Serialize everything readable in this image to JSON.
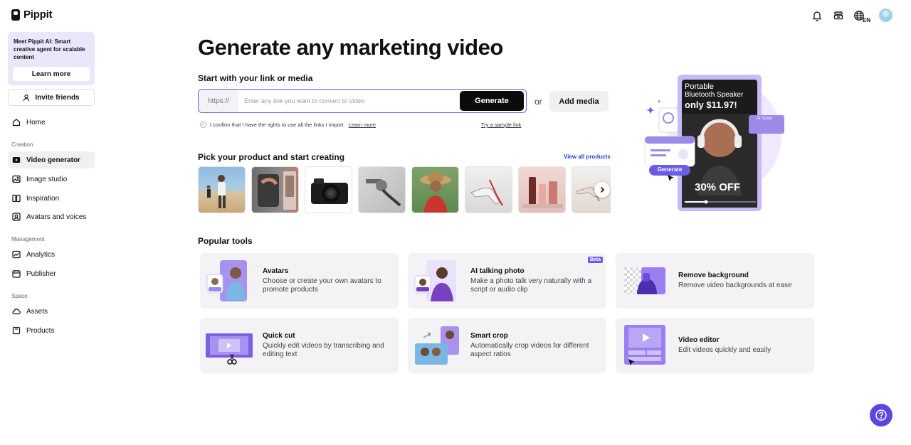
{
  "brand": {
    "name": "Pippit"
  },
  "topbar": {
    "lang_code": "EN"
  },
  "sidebar": {
    "promo": {
      "text": "Meet Pippit AI: Smart creative agent for scalable content",
      "button": "Learn more"
    },
    "invite": "Invite friends",
    "home": "Home",
    "sections": {
      "creation": "Creation",
      "management": "Management",
      "space": "Space"
    },
    "items": {
      "video_generator": "Video generator",
      "image_studio": "Image studio",
      "inspiration": "Inspiration",
      "avatars_voices": "Avatars and voices",
      "analytics": "Analytics",
      "publisher": "Publisher",
      "assets": "Assets",
      "products": "Products"
    }
  },
  "main": {
    "title": "Generate any marketing video",
    "start_label": "Start with your link or media",
    "link": {
      "prefix": "https://",
      "placeholder": "Enter any link you want to convert to video",
      "value": "",
      "generate": "Generate"
    },
    "or": "or",
    "add_media": "Add media",
    "confirm_text": "I confirm that I have the rights to use all the links I import.",
    "confirm_link": "Learn more",
    "sample_link": "Try a sample link",
    "pick_label": "Pick your product and start creating",
    "view_all": "View all products",
    "popular_label": "Popular tools",
    "tools": [
      {
        "title": "Avatars",
        "desc": "Choose or create your own avatars to promote products"
      },
      {
        "title": "AI talking photo",
        "desc": "Make a photo talk very naturally with a script or audio clip",
        "badge": "Beta"
      },
      {
        "title": "Remove background",
        "desc": "Remove video backgrounds at ease"
      },
      {
        "title": "Quick cut",
        "desc": "Quickly edit videos by transcribing and editing text"
      },
      {
        "title": "Smart crop",
        "desc": "Automatically crop videos for different aspect ratios"
      },
      {
        "title": "Video editor",
        "desc": "Edit videos quickly and easily"
      }
    ]
  },
  "hero": {
    "line1": "Portable",
    "line2": "Bluetooth Speaker",
    "price": "only $11.97!",
    "discount": "30% OFF",
    "ai_voice": "AI Voice",
    "generate": "Generate"
  },
  "colors": {
    "accent": "#6b5ce7",
    "primary_button": "#0b0b0b",
    "link": "#2a3ad8",
    "promo_bg": "#ece6fb"
  }
}
